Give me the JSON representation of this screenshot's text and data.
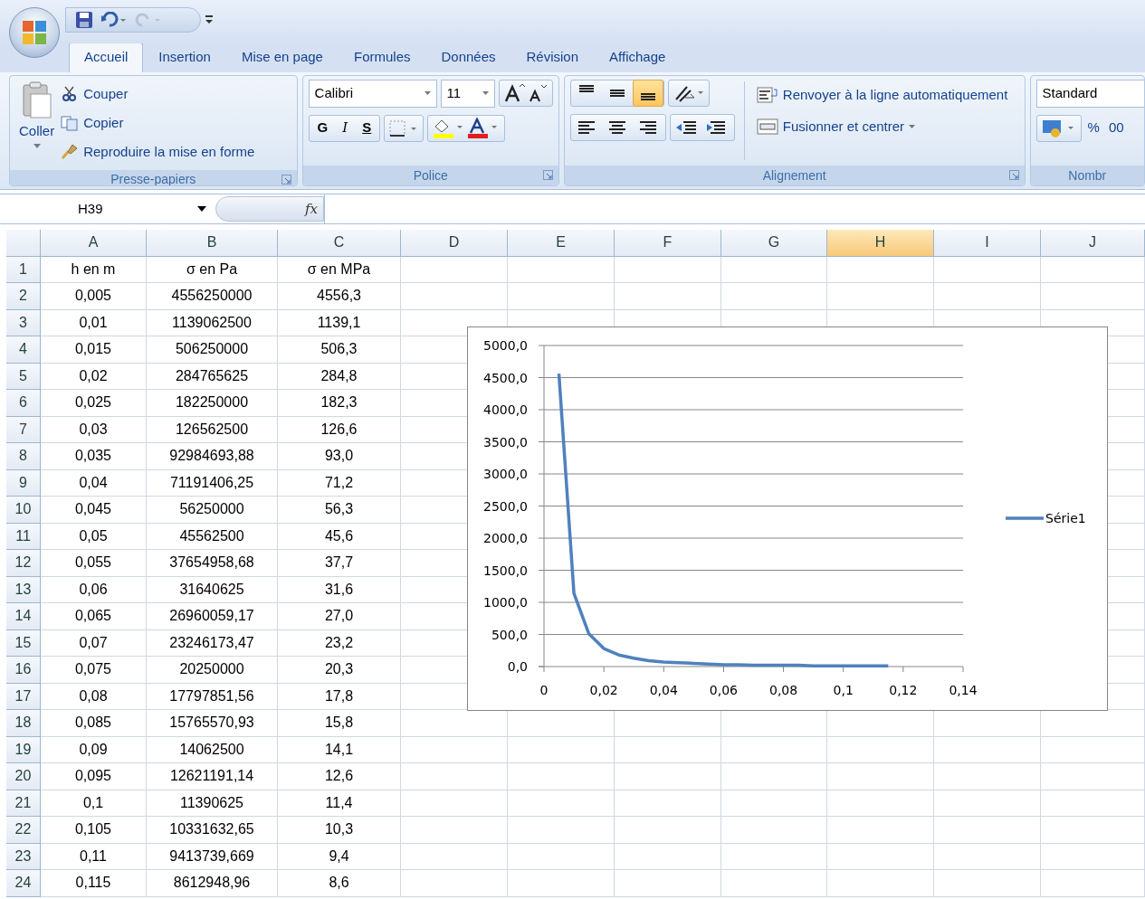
{
  "tabs": [
    {
      "label": "Accueil",
      "selected": true
    },
    {
      "label": "Insertion",
      "selected": false
    },
    {
      "label": "Mise en page",
      "selected": false
    },
    {
      "label": "Formules",
      "selected": false
    },
    {
      "label": "Données",
      "selected": false
    },
    {
      "label": "Révision",
      "selected": false
    },
    {
      "label": "Affichage",
      "selected": false
    }
  ],
  "ribbon": {
    "clipboard": {
      "label": "Presse-papiers",
      "paste": "Coller",
      "items": [
        "Couper",
        "Copier",
        "Reproduire la mise en forme"
      ]
    },
    "font": {
      "label": "Police",
      "name": "Calibri",
      "size": "11",
      "bold": "G",
      "italic": "I",
      "underline": "S"
    },
    "alignment": {
      "label": "Alignement",
      "vertical": [
        {
          "selected": false
        },
        {
          "selected": false
        },
        {
          "selected": true
        }
      ],
      "wrap": "Renvoyer à la ligne automatiquement",
      "merge": "Fusionner et centrer"
    },
    "number": {
      "label": "Nombr",
      "format": "Standard",
      "percent": "%",
      "thousands": "00"
    }
  },
  "formula_bar": {
    "cell_ref": "H39",
    "fx": "fx"
  },
  "sheet": {
    "columns": [
      {
        "label": "A",
        "selected": false
      },
      {
        "label": "B",
        "selected": false
      },
      {
        "label": "C",
        "selected": false
      },
      {
        "label": "D",
        "selected": false
      },
      {
        "label": "E",
        "selected": false
      },
      {
        "label": "F",
        "selected": false
      },
      {
        "label": "G",
        "selected": false
      },
      {
        "label": "H",
        "selected": true
      },
      {
        "label": "I",
        "selected": false
      },
      {
        "label": "J",
        "selected": false
      }
    ],
    "rows": [
      {
        "number": "1",
        "cells": [
          "h en m",
          "σ en Pa",
          "σ en MPa"
        ]
      },
      {
        "number": "2",
        "cells": [
          "0,005",
          "4556250000",
          "4556,3"
        ]
      },
      {
        "number": "3",
        "cells": [
          "0,01",
          "1139062500",
          "1139,1"
        ]
      },
      {
        "number": "4",
        "cells": [
          "0,015",
          "506250000",
          "506,3"
        ]
      },
      {
        "number": "5",
        "cells": [
          "0,02",
          "284765625",
          "284,8"
        ]
      },
      {
        "number": "6",
        "cells": [
          "0,025",
          "182250000",
          "182,3"
        ]
      },
      {
        "number": "7",
        "cells": [
          "0,03",
          "126562500",
          "126,6"
        ]
      },
      {
        "number": "8",
        "cells": [
          "0,035",
          "92984693,88",
          "93,0"
        ]
      },
      {
        "number": "9",
        "cells": [
          "0,04",
          "71191406,25",
          "71,2"
        ]
      },
      {
        "number": "10",
        "cells": [
          "0,045",
          "56250000",
          "56,3"
        ]
      },
      {
        "number": "11",
        "cells": [
          "0,05",
          "45562500",
          "45,6"
        ]
      },
      {
        "number": "12",
        "cells": [
          "0,055",
          "37654958,68",
          "37,7"
        ]
      },
      {
        "number": "13",
        "cells": [
          "0,06",
          "31640625",
          "31,6"
        ]
      },
      {
        "number": "14",
        "cells": [
          "0,065",
          "26960059,17",
          "27,0"
        ]
      },
      {
        "number": "15",
        "cells": [
          "0,07",
          "23246173,47",
          "23,2"
        ]
      },
      {
        "number": "16",
        "cells": [
          "0,075",
          "20250000",
          "20,3"
        ]
      },
      {
        "number": "17",
        "cells": [
          "0,08",
          "17797851,56",
          "17,8"
        ]
      },
      {
        "number": "18",
        "cells": [
          "0,085",
          "15765570,93",
          "15,8"
        ]
      },
      {
        "number": "19",
        "cells": [
          "0,09",
          "14062500",
          "14,1"
        ]
      },
      {
        "number": "20",
        "cells": [
          "0,095",
          "12621191,14",
          "12,6"
        ]
      },
      {
        "number": "21",
        "cells": [
          "0,1",
          "11390625",
          "11,4"
        ]
      },
      {
        "number": "22",
        "cells": [
          "0,105",
          "10331632,65",
          "10,3"
        ]
      },
      {
        "number": "23",
        "cells": [
          "0,11",
          "9413739,669",
          "9,4"
        ]
      },
      {
        "number": "24",
        "cells": [
          "0,115",
          "8612948,96",
          "8,6"
        ]
      }
    ],
    "chart_data": {
      "type": "line",
      "x": [
        0.005,
        0.01,
        0.015,
        0.02,
        0.025,
        0.03,
        0.035,
        0.04,
        0.045,
        0.05,
        0.055,
        0.06,
        0.065,
        0.07,
        0.075,
        0.08,
        0.085,
        0.09,
        0.095,
        0.1,
        0.105,
        0.11,
        0.115
      ],
      "series": [
        {
          "name": "Série1",
          "color": "#4f81bd",
          "values": [
            4560,
            1140,
            510,
            280,
            180,
            130,
            90,
            70,
            60,
            50,
            40,
            30,
            30,
            20,
            20,
            20,
            20,
            10,
            10,
            10,
            10,
            10,
            10
          ]
        }
      ],
      "xlim": [
        0,
        0.14
      ],
      "ylim": [
        0,
        5000
      ],
      "grid": true,
      "xticks": [
        {
          "value": 0,
          "label": "0"
        },
        {
          "value": 0.02,
          "label": "0,02"
        },
        {
          "value": 0.04,
          "label": "0,04"
        },
        {
          "value": 0.06,
          "label": "0,06"
        },
        {
          "value": 0.08,
          "label": "0,08"
        },
        {
          "value": 0.1,
          "label": "0,1"
        },
        {
          "value": 0.12,
          "label": "0,12"
        },
        {
          "value": 0.14,
          "label": "0,14"
        }
      ],
      "yticks": [
        {
          "value": 0,
          "label": "0,0"
        },
        {
          "value": 500,
          "label": "500,0"
        },
        {
          "value": 1000,
          "label": "1000,0"
        },
        {
          "value": 1500,
          "label": "1500,0"
        },
        {
          "value": 2000,
          "label": "2000,0"
        },
        {
          "value": 2500,
          "label": "2500,0"
        },
        {
          "value": 3000,
          "label": "3000,0"
        },
        {
          "value": 3500,
          "label": "3500,0"
        },
        {
          "value": 4000,
          "label": "4000,0"
        },
        {
          "value": 4500,
          "label": "4500,0"
        },
        {
          "value": 5000,
          "label": "5000,0"
        }
      ]
    }
  }
}
